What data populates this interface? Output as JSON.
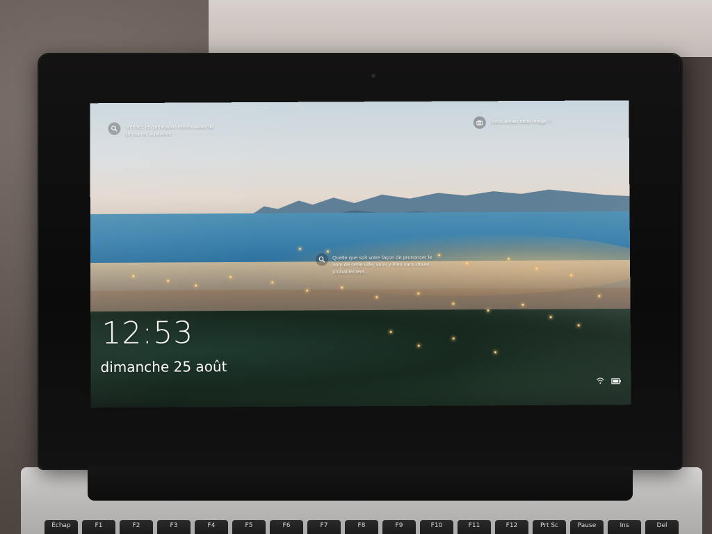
{
  "lock_screen": {
    "time": "12:53",
    "date": "dimanche 25 août",
    "spotlight": {
      "weather_tip": "Vérifiez les prévisions météo avant de démarrer la journée",
      "like_prompt": "Vous aimez cette image ?",
      "location_hint": "Quelle que soit votre façon de prononcer le nom de cette ville, vous y êtes sans doute probablement..."
    },
    "icons": {
      "weather_tip_icon": "search-icon",
      "like_prompt_icon": "camera-icon",
      "location_hint_icon": "search-icon",
      "network_icon": "wifi-icon",
      "battery_icon": "battery-icon"
    }
  },
  "keyboard": {
    "keys": [
      "Échap",
      "F1",
      "F2",
      "F3",
      "F4",
      "F5",
      "F6",
      "F7",
      "F8",
      "F9",
      "F10",
      "F11",
      "F12",
      "Prt Sc",
      "Pause",
      "Ins",
      "Del"
    ]
  },
  "colors": {
    "bezel": "#0b0b0b",
    "screen_text": "#ffffff",
    "sea": "#3c82ad",
    "city_glow": "#ffd38a"
  }
}
